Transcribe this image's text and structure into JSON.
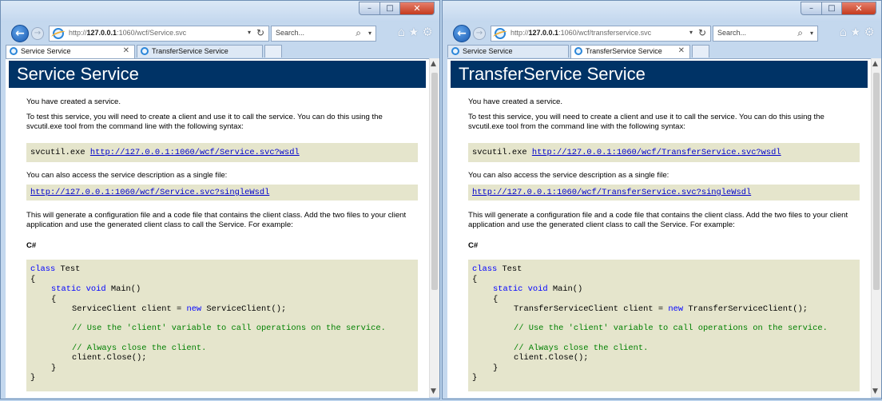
{
  "left": {
    "address_prefix": "http://",
    "address_host": "127.0.0.1",
    "address_suffix": ":1060/wcf/Service.svc",
    "search_placeholder": "Search...",
    "tab1": "Service Service",
    "tab2": "TransferService Service",
    "page": {
      "title": "Service Service",
      "p1": "You have created a service.",
      "p2": "To test this service, you will need to create a client and use it to call the service. You can do this using the svcutil.exe tool from the command line with the following syntax:",
      "cmd": "svcutil.exe",
      "wsdl_link": "http://127.0.0.1:1060/wcf/Service.svc?wsdl",
      "p3": "You can also access the service description as a single file:",
      "single_link": "http://127.0.0.1:1060/wcf/Service.svc?singleWsdl",
      "p4": "This will generate a configuration file and a code file that contains the client class. Add the two files to your client application and use the generated client class to call the Service. For example:",
      "lang": "C#",
      "code_client_type": "ServiceClient",
      "code_ctor": "ServiceClient();"
    }
  },
  "right": {
    "address_prefix": "http://",
    "address_host": "127.0.0.1",
    "address_suffix": ":1060/wcf/transferservice.svc",
    "search_placeholder": "Search...",
    "tab1": "Service Service",
    "tab2": "TransferService Service",
    "page": {
      "title": "TransferService Service",
      "p1": "You have created a service.",
      "p2": "To test this service, you will need to create a client and use it to call the service. You can do this using the svcutil.exe tool from the command line with the following syntax:",
      "cmd": "svcutil.exe",
      "wsdl_link": "http://127.0.0.1:1060/wcf/TransferService.svc?wsdl",
      "p3": "You can also access the service description as a single file:",
      "single_link": "http://127.0.0.1:1060/wcf/TransferService.svc?singleWsdl",
      "p4": "This will generate a configuration file and a code file that contains the client class. Add the two files to your client application and use the generated client class to call the Service. For example:",
      "lang": "C#",
      "code_client_type": "TransferServiceClient",
      "code_ctor": "TransferServiceClient();"
    }
  },
  "code": {
    "kw_class": "class",
    "class_name": "Test",
    "brace_open": "{",
    "brace_close": "}",
    "kw_static_void": "static void",
    "main_sig": "Main()",
    "var_decl": "client =",
    "kw_new": "new",
    "comment1": "// Use the 'client' variable to call operations on the service.",
    "comment2": "// Always close the client.",
    "close_call": "client.Close();"
  },
  "icons": {
    "back": "back-arrow-icon",
    "forward": "forward-arrow-icon",
    "refresh": "refresh-icon",
    "search": "search-icon",
    "home": "home-icon",
    "favorites": "star-icon",
    "tools": "gear-icon",
    "minimize": "minimize-icon",
    "maximize": "maximize-icon",
    "close": "close-icon"
  }
}
